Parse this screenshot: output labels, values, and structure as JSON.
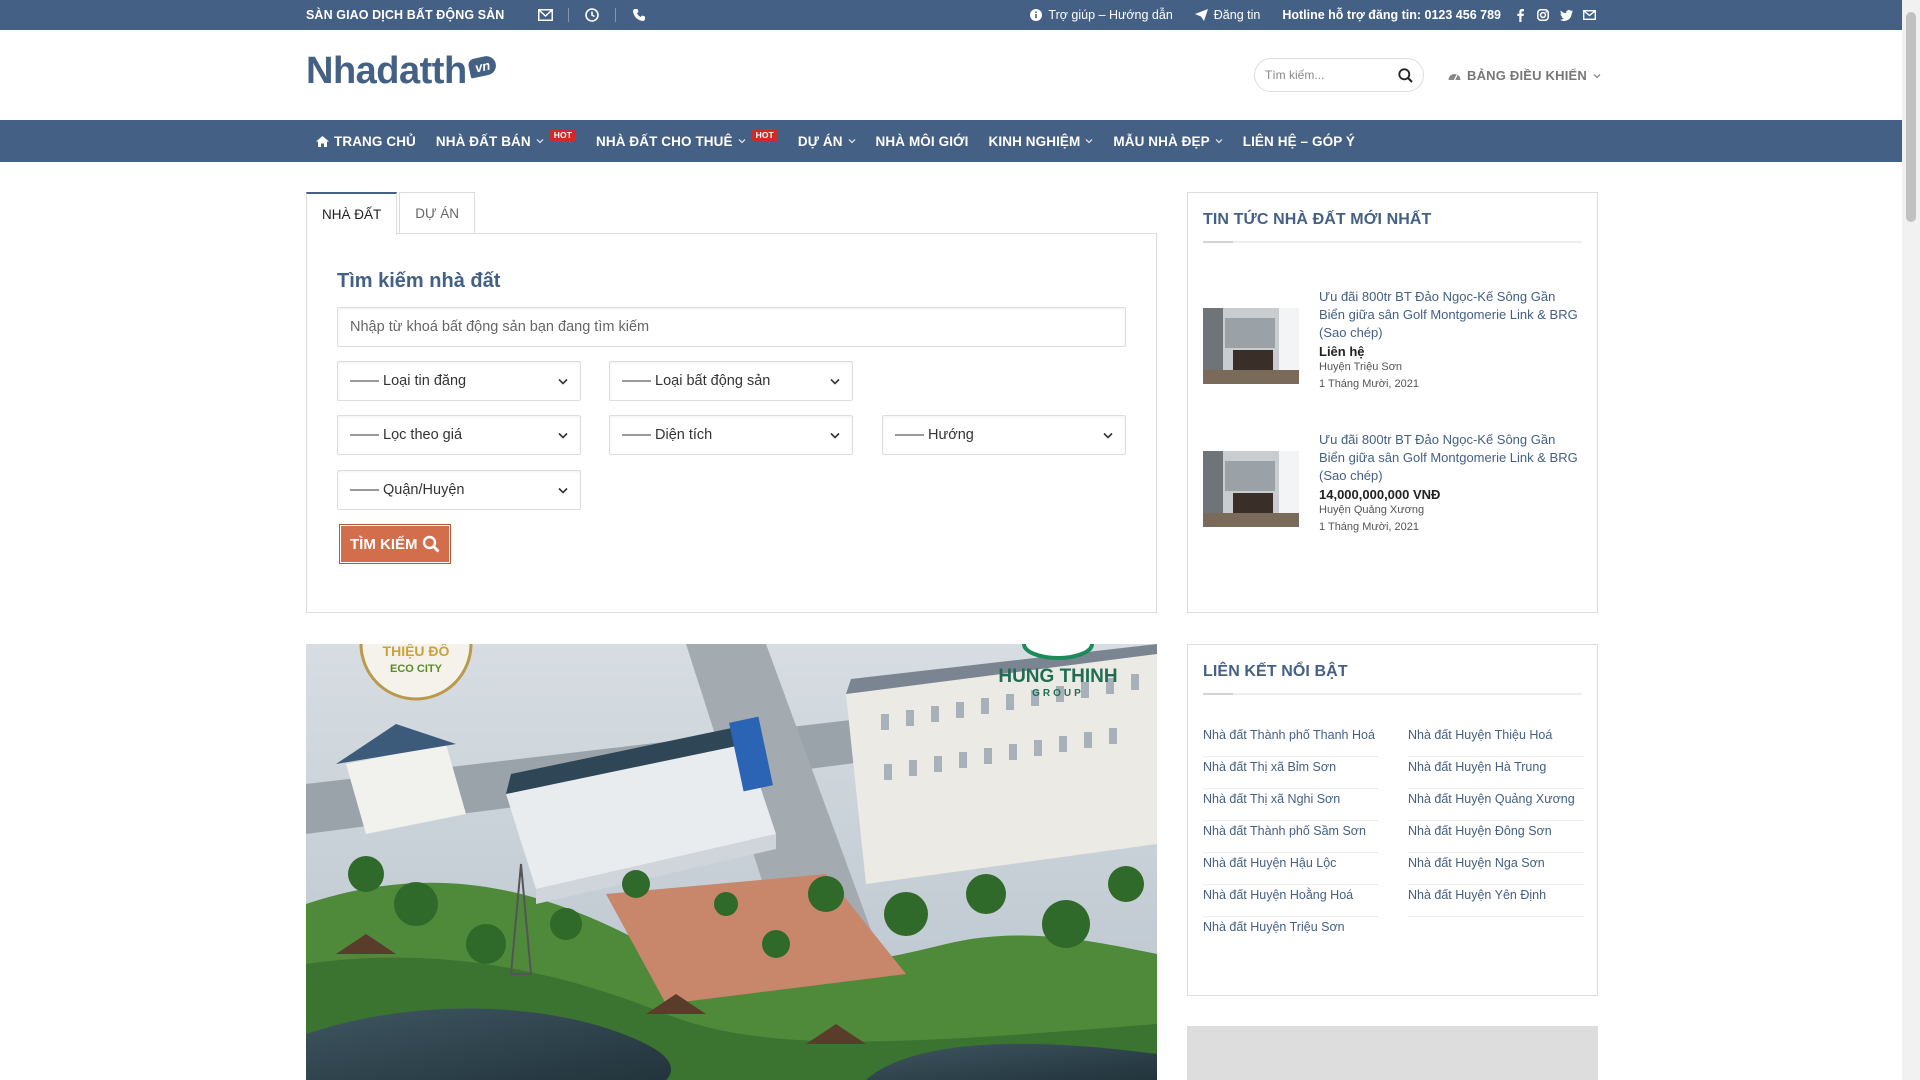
{
  "colors": {
    "brand": "#446084",
    "accent": "#d26e4b",
    "hot": "#d02a2a"
  },
  "topbar": {
    "brand_tag": "SÀN GIAO DỊCH BẤT ĐỘNG SẢN",
    "help": "Trợ giúp – Hướng dẫn",
    "post": "Đăng tin",
    "hotline": "Hotline hỗ trợ đăng tin: 0123 456 789"
  },
  "header": {
    "logo_text": "Nhadatth",
    "logo_badge": "vn",
    "search_placeholder": "Tìm kiếm...",
    "dashboard": "BẢNG ĐIỀU KHIỂN"
  },
  "nav": {
    "items": [
      {
        "label": "TRANG CHỦ"
      },
      {
        "label": "NHÀ ĐẤT BÁN",
        "badge": "HOT"
      },
      {
        "label": "NHÀ ĐẤT CHO THUÊ",
        "badge": "HOT"
      },
      {
        "label": "DỰ ÁN"
      },
      {
        "label": "NHÀ MÔI GIỚI"
      },
      {
        "label": "KINH NGHIỆM"
      },
      {
        "label": "MẪU NHÀ ĐẸP"
      },
      {
        "label": "LIÊN HỆ – GÓP Ý"
      }
    ]
  },
  "search_panel": {
    "tabs": [
      "NHÀ ĐẤT",
      "DỰ ÁN"
    ],
    "title": "Tìm kiếm nhà đất",
    "keyword_placeholder": "Nhập từ khoá bất động sản bạn đang tìm kiếm",
    "selects": {
      "listing_type": "—— Loại tin đăng",
      "property_type": "—— Loại bất động sản",
      "price": "—— Lọc theo giá",
      "area": "—— Diện tích",
      "direction": "—— Hướng",
      "district": "—— Quận/Huyện"
    },
    "button": "TÌM KIẾM"
  },
  "banner": {
    "logo_left_1": "THIỆU ĐÔ",
    "logo_left_2": "ECO CITY",
    "logo_right_1": "HUNG THINH",
    "logo_right_2": "GROUP"
  },
  "news_widget": {
    "title": "TIN TỨC NHÀ ĐẤT MỚI NHẤT",
    "items": [
      {
        "title": "Ưu đãi 800tr BT Đảo Ngọc-Kế Sông Gần Biển giữa sân Golf Montgomerie Link & BRG (Sao chép)",
        "price": "Liên hệ",
        "location": "Huyện Triệu Sơn",
        "date": "1 Tháng Mười, 2021"
      },
      {
        "title": "Ưu đãi 800tr BT Đảo Ngọc-Kế Sông Gần Biển giữa sân Golf Montgomerie Link & BRG (Sao chép)",
        "price": "14,000,000,000 VNĐ",
        "location": "Huyện Quảng Xương",
        "date": "1 Tháng Mười, 2021"
      }
    ]
  },
  "links_widget": {
    "title": "LIÊN KẾT NỔI BẬT",
    "left": [
      "Nhà đất Thành phố Thanh Hoá",
      "Nhà đất Thị xã Bỉm Sơn",
      "Nhà đất Thị xã Nghi Sơn",
      "Nhà đất Thành phố Sầm Sơn",
      "Nhà đất Huyện Hậu Lộc",
      "Nhà đất Huyện Hoằng Hoá",
      "Nhà đất Huyện Triệu Sơn"
    ],
    "right": [
      "Nhà đất Huyện Thiệu Hoá",
      "Nhà đất Huyện Hà Trung",
      "Nhà đất Huyện Quảng Xương",
      "Nhà đất Huyện Đông Sơn",
      "Nhà đất Huyện Nga Sơn",
      "Nhà đất Huyện Yên Định"
    ]
  },
  "icons": [
    "envelope-icon",
    "clock-icon",
    "phone-icon",
    "info-icon",
    "send-icon",
    "facebook-icon",
    "instagram-icon",
    "twitter-icon",
    "mail-icon",
    "search-icon",
    "dashboard-icon",
    "home-icon",
    "chevron-down-icon"
  ]
}
